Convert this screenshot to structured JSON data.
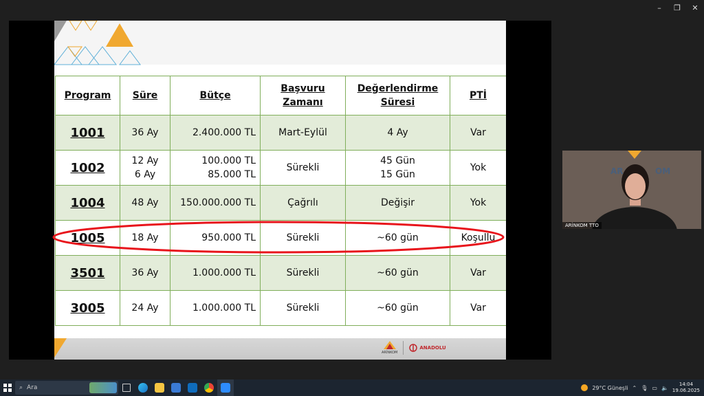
{
  "window": {
    "minimize_glyph": "–",
    "maximize_glyph": "❐",
    "close_glyph": "✕"
  },
  "table": {
    "headers": [
      {
        "line1": "Program",
        "line2": ""
      },
      {
        "line1": "Süre",
        "line2": ""
      },
      {
        "line1": "Bütçe",
        "line2": ""
      },
      {
        "line1": "Başvuru",
        "line2": "Zamanı"
      },
      {
        "line1": "Değerlendirme",
        "line2": "Süresi"
      },
      {
        "line1": "PTİ",
        "line2": ""
      }
    ],
    "rows": [
      {
        "program": "1001",
        "sure": [
          "36 Ay"
        ],
        "butce": [
          "2.400.000 TL"
        ],
        "basvuru": "Mart-Eylül",
        "deger": [
          "4 Ay"
        ],
        "pti": "Var"
      },
      {
        "program": "1002",
        "sure": [
          "12 Ay",
          "6 Ay"
        ],
        "butce": [
          "100.000 TL",
          "85.000 TL"
        ],
        "basvuru": "Sürekli",
        "deger": [
          "45 Gün",
          "15 Gün"
        ],
        "pti": "Yok"
      },
      {
        "program": "1004",
        "sure": [
          "48 Ay"
        ],
        "butce": [
          "150.000.000 TL"
        ],
        "basvuru": "Çağrılı",
        "deger": [
          "Değişir"
        ],
        "pti": "Yok"
      },
      {
        "program": "1005",
        "sure": [
          "18 Ay"
        ],
        "butce": [
          "950.000 TL"
        ],
        "basvuru": "Sürekli",
        "deger": [
          "~60 gün"
        ],
        "pti": "Koşullu"
      },
      {
        "program": "3501",
        "sure": [
          "36 Ay"
        ],
        "butce": [
          "1.000.000 TL"
        ],
        "basvuru": "Sürekli",
        "deger": [
          "~60 gün"
        ],
        "pti": "Var"
      },
      {
        "program": "3005",
        "sure": [
          "24 Ay"
        ],
        "butce": [
          "1.000.000 TL"
        ],
        "basvuru": "Sürekli",
        "deger": [
          "~60 gün"
        ],
        "pti": "Var"
      }
    ]
  },
  "footer": {
    "logo1": "ARİNKOM",
    "logo2": "ANADOLU"
  },
  "video": {
    "participant_name": "ARİNKOM TTO"
  },
  "taskbar": {
    "search_placeholder": "Ara",
    "weather": "29°C Güneşli",
    "time": "14:04",
    "date": "19.06.2025"
  },
  "colors": {
    "table_border": "#7fae5a",
    "row_green": "#e3ecd9",
    "highlight": "#e8141b",
    "accent_orange": "#f0a830",
    "accent_blue": "#5fb0d8"
  }
}
